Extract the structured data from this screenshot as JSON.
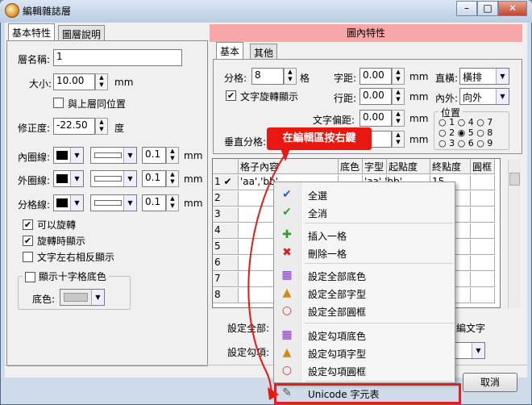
{
  "window": {
    "title": "編輯雜誌層",
    "caption_min": "–",
    "caption_max": "□",
    "caption_close": "✕"
  },
  "left_tabs": [
    "基本特性",
    "圖層說明"
  ],
  "left": {
    "layer_name_label": "層名稱:",
    "layer_name_value": "1",
    "size_label": "大小:",
    "size_value": "10.00",
    "size_unit": "mm",
    "same_pos_label": "與上層同位置",
    "rotation_label": "修正度:",
    "rotation_value": "-22.50",
    "rotation_unit": "度",
    "inner_line_label": "內圈線:",
    "inner_width": "0.1",
    "outer_line_label": "外圈線:",
    "outer_width": "0.1",
    "divider_line_label": "分格線:",
    "divider_width": "0.1",
    "line_unit": "mm",
    "can_rotate": "可以旋轉",
    "rotate_show": "旋轉時顯示",
    "text_reverse": "文字左右相反顯示",
    "cross_bg_label": "顯示十字格底色",
    "bg_color_label": "底色:"
  },
  "right": {
    "header": "圖內特性",
    "tabs": [
      "基本",
      "其他"
    ],
    "divisions_label": "分格:",
    "divisions_value": "8",
    "divisions_unit": "格",
    "char_spacing_label": "字距:",
    "char_spacing_value": "0.00",
    "unit": "mm",
    "orientation_label": "直橫:",
    "orientation_value": "橫排",
    "text_rotate_label": "文字旋轉顯示",
    "line_spacing_label": "行距:",
    "line_spacing_value": "0.00",
    "inout_label": "內外:",
    "inout_value": "向外",
    "text_offset_label": "文字偏距:",
    "text_offset_value": "0.00",
    "vert_div_label": "垂直分格:",
    "position_label": "位置",
    "position_options": [
      "1",
      "2",
      "3",
      "4",
      "5",
      "6",
      "7",
      "8",
      "9"
    ]
  },
  "grid": {
    "columns": [
      "格子內容",
      "底色",
      "字型",
      "起點度",
      "終點度",
      "圓框"
    ],
    "rows": [
      {
        "num": "1",
        "mark": "✔",
        "content": "'aa','bb'",
        "font": "'aa','bb'",
        "start": "",
        "end": "15"
      },
      {
        "num": "2",
        "mark": "",
        "content": "",
        "font": "",
        "start": "",
        "end": ""
      },
      {
        "num": "3",
        "mark": "",
        "content": "",
        "font": "",
        "start": "",
        "end": ""
      },
      {
        "num": "4",
        "mark": "",
        "content": "",
        "font": "",
        "start": "",
        "end": ""
      },
      {
        "num": "5",
        "mark": "",
        "content": "",
        "font": "",
        "start": "",
        "end": ""
      },
      {
        "num": "6",
        "mark": "",
        "content": "",
        "font": "",
        "start": "",
        "end": ""
      },
      {
        "num": "7",
        "mark": "",
        "content": "",
        "font": "",
        "start": "",
        "end": ""
      },
      {
        "num": "8",
        "mark": "",
        "content": "",
        "font": "",
        "start": "",
        "end": ""
      }
    ]
  },
  "set_all_label": "設定全部:",
  "set_checked_label": "設定勾項:",
  "edit_text_label": "編文字",
  "cancel_button": "取消",
  "callout": "在編輯區按右鍵",
  "context_menu": {
    "items": [
      {
        "label": "全選",
        "icon": "check-all-icon"
      },
      {
        "label": "全消",
        "icon": "clear-all-icon"
      },
      {
        "label": "插入一格",
        "icon": "plus-icon"
      },
      {
        "label": "刪除一格",
        "icon": "delete-icon"
      },
      {
        "label": "設定全部底色",
        "icon": "palette-icon"
      },
      {
        "label": "設定全部字型",
        "icon": "font-icon"
      },
      {
        "label": "設定全部圓框",
        "icon": "circle-icon"
      },
      {
        "label": "設定勾項底色",
        "icon": "palette-icon"
      },
      {
        "label": "設定勾項字型",
        "icon": "font-icon"
      },
      {
        "label": "設定勾項圓框",
        "icon": "circle-icon"
      },
      {
        "label": "Unicode 字元表",
        "icon": "unicode-icon"
      }
    ]
  },
  "colors": {
    "callout_red": "#e8170f",
    "header_pink": "#f7a7a7"
  }
}
